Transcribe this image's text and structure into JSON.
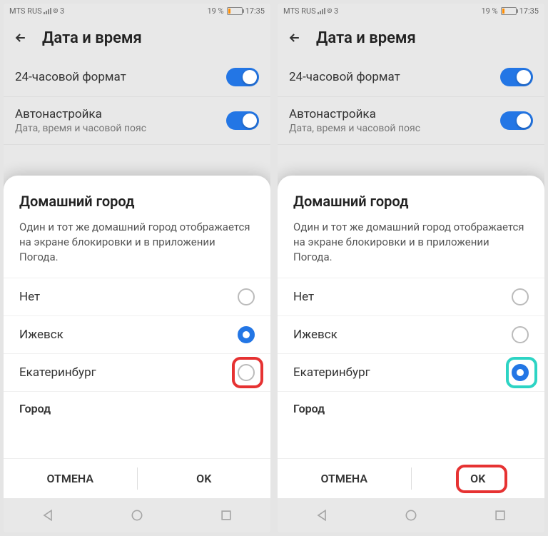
{
  "status": {
    "carrier": "MTS RUS",
    "sim": "3",
    "battery_pct": "19 %",
    "time": "17:35"
  },
  "header": {
    "title": "Дата и время"
  },
  "settings": {
    "format24_label": "24-часовой формат",
    "auto_label": "Автонастройка",
    "auto_sub": "Дата, время и часовой пояс"
  },
  "dialog": {
    "title": "Домашний город",
    "desc": "Один и тот же домашний город отображается на экране блокировки и в приложении Погода.",
    "option_none": "Нет",
    "option_izhevsk": "Ижевск",
    "option_ekb": "Екатеринбург",
    "city_label": "Город",
    "cancel": "ОТМЕНА",
    "ok": "OK"
  }
}
